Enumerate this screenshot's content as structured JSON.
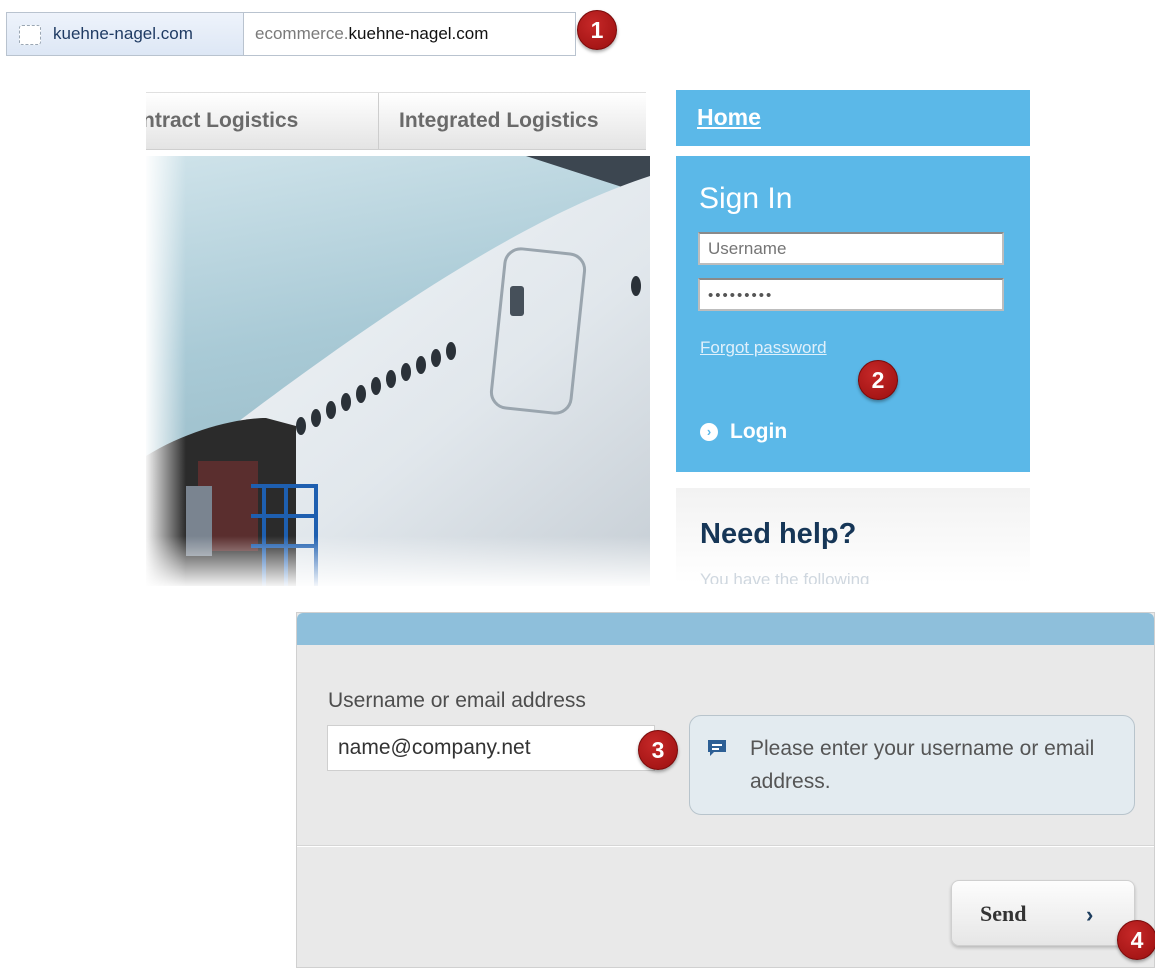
{
  "browser": {
    "site_identity": "kuehne-nagel.com",
    "url_prefix": "ecommerce.",
    "url_domain": "kuehne-nagel.com"
  },
  "nav": {
    "tabs": [
      {
        "label": "ntract Logistics"
      },
      {
        "label": "Integrated Logistics"
      }
    ]
  },
  "sidebar": {
    "home_label": "Home",
    "signin": {
      "title": "Sign In",
      "username_placeholder": "Username",
      "password_value": "•••••••••",
      "forgot_label": "Forgot password",
      "login_label": "Login"
    },
    "help": {
      "title": "Need help?",
      "subtitle": "You have the following"
    }
  },
  "form": {
    "label": "Username or email address",
    "email_value": "name@company.net",
    "tooltip": "Please enter your username or email address.",
    "send_label": "Send",
    "send_arrow": "›"
  },
  "callouts": [
    "1",
    "2",
    "3",
    "4"
  ],
  "colors": {
    "sidebar_blue": "#5bb8e8",
    "form_header_blue": "#8ebfdb",
    "callout_red": "#b71c1c",
    "heading_navy": "#163657"
  }
}
